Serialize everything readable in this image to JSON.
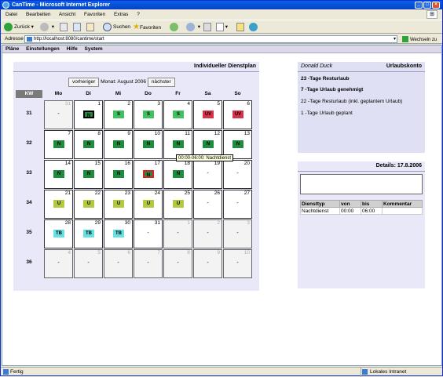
{
  "window": {
    "title": "CanTime - Microsoft Internet Explorer"
  },
  "menu": [
    "Datei",
    "Bearbeiten",
    "Ansicht",
    "Favoriten",
    "Extras",
    "?"
  ],
  "toolbar": {
    "back": "Zurück",
    "search": "Suchen",
    "favorites": "Favoriten"
  },
  "address": {
    "label": "Adresse",
    "url": "http://localhost:8080/cantime/start",
    "go": "Wechseln zu"
  },
  "appnav": [
    "Pläne",
    "Einstellungen",
    "Hilfe",
    "System"
  ],
  "plan": {
    "title": "Individueller Dienstplan",
    "prev": "vorheriger",
    "month_label": "Monat:",
    "month": "August",
    "year": "2006",
    "next": "nächster",
    "kw_header": "KW",
    "weekdays": [
      "Mo",
      "Di",
      "Mi",
      "Do",
      "Fr",
      "Sa",
      "So"
    ]
  },
  "weeks": [
    {
      "kw": "31",
      "days": [
        {
          "num": "31",
          "out": true,
          "badge": "",
          "dash": true
        },
        {
          "num": "1",
          "badge": "N",
          "style": "sel"
        },
        {
          "num": "2",
          "badge": "S"
        },
        {
          "num": "3",
          "badge": "S"
        },
        {
          "num": "4",
          "badge": "S"
        },
        {
          "num": "5",
          "badge": "UV"
        },
        {
          "num": "6",
          "badge": "UV"
        }
      ]
    },
    {
      "kw": "32",
      "days": [
        {
          "num": "7",
          "badge": "N"
        },
        {
          "num": "8",
          "badge": "N"
        },
        {
          "num": "9",
          "badge": "N"
        },
        {
          "num": "10",
          "badge": "N"
        },
        {
          "num": "11",
          "badge": "N"
        },
        {
          "num": "12",
          "badge": "N"
        },
        {
          "num": "13",
          "badge": "N"
        }
      ]
    },
    {
      "kw": "33",
      "days": [
        {
          "num": "14",
          "badge": "N"
        },
        {
          "num": "15",
          "badge": "N"
        },
        {
          "num": "16",
          "badge": "N"
        },
        {
          "num": "17",
          "badge": "N",
          "style": "sel2"
        },
        {
          "num": "18",
          "badge": "N"
        },
        {
          "num": "19",
          "badge": "",
          "dash": true
        },
        {
          "num": "20",
          "badge": "",
          "dash": true
        }
      ]
    },
    {
      "kw": "34",
      "days": [
        {
          "num": "21",
          "badge": "U"
        },
        {
          "num": "22",
          "badge": "U"
        },
        {
          "num": "23",
          "badge": "U"
        },
        {
          "num": "24",
          "badge": "U"
        },
        {
          "num": "25",
          "badge": "U"
        },
        {
          "num": "26",
          "badge": "",
          "dash": true
        },
        {
          "num": "27",
          "badge": "",
          "dash": true
        }
      ]
    },
    {
      "kw": "35",
      "days": [
        {
          "num": "28",
          "badge": "TB"
        },
        {
          "num": "29",
          "badge": "TB"
        },
        {
          "num": "30",
          "badge": "TB"
        },
        {
          "num": "31",
          "badge": "",
          "dash": true
        },
        {
          "num": "1",
          "out": true,
          "badge": "",
          "dash": true
        },
        {
          "num": "2",
          "out": true,
          "badge": "",
          "dash": true
        },
        {
          "num": "3",
          "out": true,
          "badge": "",
          "dash": true
        }
      ]
    },
    {
      "kw": "36",
      "days": [
        {
          "num": "4",
          "out": true,
          "badge": "",
          "dash": true
        },
        {
          "num": "5",
          "out": true,
          "badge": "",
          "dash": true
        },
        {
          "num": "6",
          "out": true,
          "badge": "",
          "dash": true
        },
        {
          "num": "7",
          "out": true,
          "badge": "",
          "dash": true
        },
        {
          "num": "8",
          "out": true,
          "badge": "",
          "dash": true
        },
        {
          "num": "9",
          "out": true,
          "badge": "",
          "dash": true
        },
        {
          "num": "10",
          "out": true,
          "badge": "",
          "dash": true
        }
      ]
    }
  ],
  "dash_text": "-",
  "tooltip": "00:00-06:00: Nachtdienst",
  "konto": {
    "user": "Donald Duck",
    "title": "Urlaubskonto",
    "lines": [
      {
        "text": "23 -Tage Resturlaub",
        "bold": true
      },
      {
        "text": "7 -Tage Urlaub genehmigt",
        "bold": true
      },
      {
        "text": "22 -Tage Resturlaub (inkl. geplantem Urlaub)",
        "bold": false
      },
      {
        "text": "1 -Tage Urlaub geplant",
        "bold": false
      }
    ]
  },
  "details": {
    "title": "Details: 17.8.2006",
    "columns": [
      "Diensttyp",
      "von",
      "bis",
      "Kommentar"
    ],
    "rows": [
      [
        "Nachtdienst",
        "00:00",
        "06:00",
        ""
      ]
    ]
  },
  "status": {
    "left": "Fertig",
    "right": "Lokales Intranet"
  },
  "colors": {
    "N": "#1e8c3c",
    "S": "#40c060",
    "UV": "#d8324a",
    "U": "#b4c840",
    "TB": "#66e0e0"
  }
}
